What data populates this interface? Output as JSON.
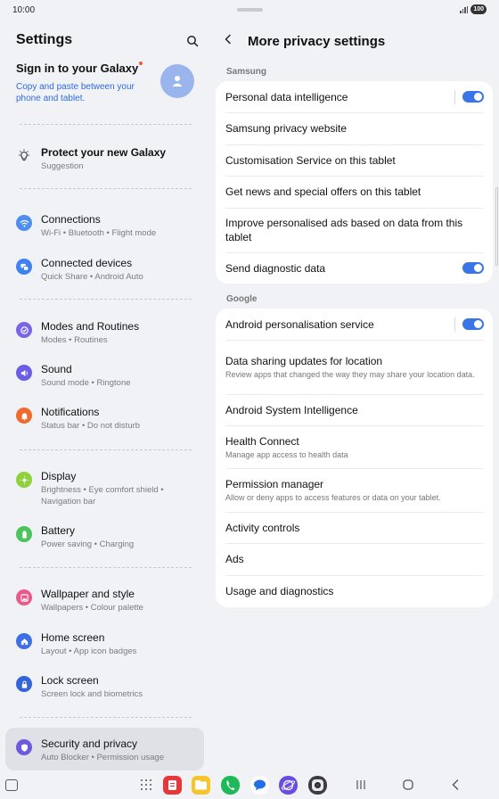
{
  "status": {
    "time": "10:00",
    "battery": "100"
  },
  "left": {
    "title": "Settings",
    "account": {
      "title": "Sign in to your Galaxy",
      "subtitle": "Copy and paste between your phone and tablet."
    },
    "suggestion": {
      "label": "Protect your new Galaxy",
      "sub": "Suggestion"
    },
    "items": [
      {
        "label": "Connections",
        "sub": "Wi-Fi  •  Bluetooth  •  Flight mode",
        "icon": "wifi-icon",
        "color": "#4c8ff0"
      },
      {
        "label": "Connected devices",
        "sub": "Quick Share  •  Android Auto",
        "icon": "devices-icon",
        "color": "#3e82ef"
      },
      {
        "label": "Modes and Routines",
        "sub": "Modes  •  Routines",
        "icon": "modes-icon",
        "color": "#7a65e8"
      },
      {
        "label": "Sound",
        "sub": "Sound mode  •  Ringtone",
        "icon": "sound-icon",
        "color": "#6b5ee6"
      },
      {
        "label": "Notifications",
        "sub": "Status bar  •  Do not disturb",
        "icon": "bell-icon",
        "color": "#f06a2e"
      },
      {
        "label": "Display",
        "sub": "Brightness  •  Eye comfort shield  •  Navigation bar",
        "icon": "sun-icon",
        "color": "#8ed13a"
      },
      {
        "label": "Battery",
        "sub": "Power saving  •  Charging",
        "icon": "battery-icon",
        "color": "#4cc35c"
      },
      {
        "label": "Wallpaper and style",
        "sub": "Wallpapers  •  Colour palette",
        "icon": "wallpaper-icon",
        "color": "#e95a8a"
      },
      {
        "label": "Home screen",
        "sub": "Layout  •  App icon badges",
        "icon": "home-icon",
        "color": "#3d6fe6"
      },
      {
        "label": "Lock screen",
        "sub": "Screen lock and biometrics",
        "icon": "lock-icon",
        "color": "#3563d9"
      },
      {
        "label": "Security and privacy",
        "sub": "Auto Blocker  •  Permission usage",
        "icon": "shield-icon",
        "color": "#6a5be0"
      }
    ]
  },
  "right": {
    "title": "More privacy settings",
    "sections": [
      {
        "label": "Samsung",
        "items": [
          {
            "label": "Personal data intelligence",
            "toggle": true
          },
          {
            "label": "Samsung privacy website"
          },
          {
            "label": "Customisation Service on this tablet"
          },
          {
            "label": "Get news and special offers on this tablet"
          },
          {
            "label": "Improve personalised ads based on data from this tablet"
          },
          {
            "label": "Send diagnostic data",
            "toggle": true
          }
        ]
      },
      {
        "label": "Google",
        "items": [
          {
            "label": "Android personalisation service",
            "toggle": true
          },
          {
            "label": "Data sharing updates for location",
            "sub": "Review apps that changed the way they may share your location data."
          },
          {
            "label": "Android System Intelligence"
          },
          {
            "label": "Health Connect",
            "sub": "Manage app access to health data"
          },
          {
            "label": "Permission manager",
            "sub": "Allow or deny apps to access features or data on your tablet."
          },
          {
            "label": "Activity controls"
          },
          {
            "label": "Ads"
          },
          {
            "label": "Usage and diagnostics"
          }
        ]
      }
    ]
  },
  "taskbar": {
    "apps": [
      {
        "name": "app-red-icon",
        "color": "#e8373a"
      },
      {
        "name": "app-yellow-icon",
        "color": "#f7c42a"
      },
      {
        "name": "phone-app-icon",
        "color": "#1fb95a"
      },
      {
        "name": "messages-app-icon",
        "color": "#1f6fe5"
      },
      {
        "name": "internet-app-icon",
        "color": "#6a4ee0"
      },
      {
        "name": "camera-app-icon",
        "color": "#3b3b40"
      }
    ]
  }
}
